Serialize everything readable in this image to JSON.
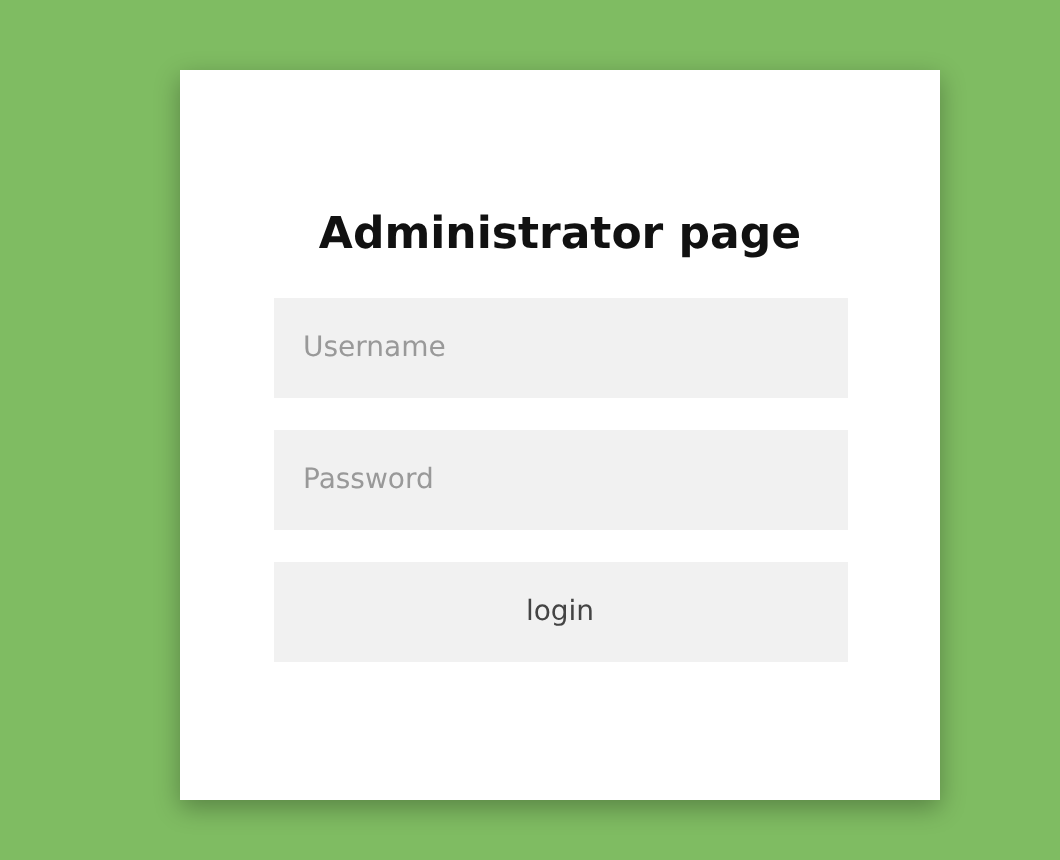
{
  "title": "Administrator page",
  "fields": [
    {
      "placeholder": "Username"
    },
    {
      "placeholder": "Password"
    }
  ],
  "button": "login"
}
